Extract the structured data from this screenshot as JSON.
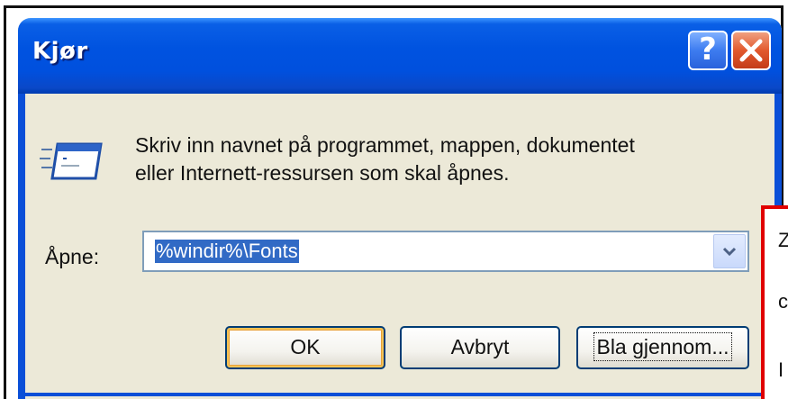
{
  "window": {
    "title": "Kjør",
    "help_label": "?",
    "close_label": "✕"
  },
  "dialog": {
    "description_line1": "Skriv inn navnet på programmet, mappen, dokumentet",
    "description_line2": "eller Internett-ressursen som skal åpnes.",
    "open_label": "Åpne:",
    "open_value": "%windir%\\Fonts",
    "icon": "run-icon"
  },
  "buttons": {
    "ok": "OK",
    "cancel": "Avbryt",
    "browse": "Bla gjennom..."
  },
  "annotation": {
    "line1": "Z",
    "line2": "c",
    "line3": "I"
  },
  "colors": {
    "title_bar": "#0053e0",
    "dialog_bg": "#ece9d8",
    "selection": "#316ac5",
    "annotation_border": "#e00000"
  }
}
